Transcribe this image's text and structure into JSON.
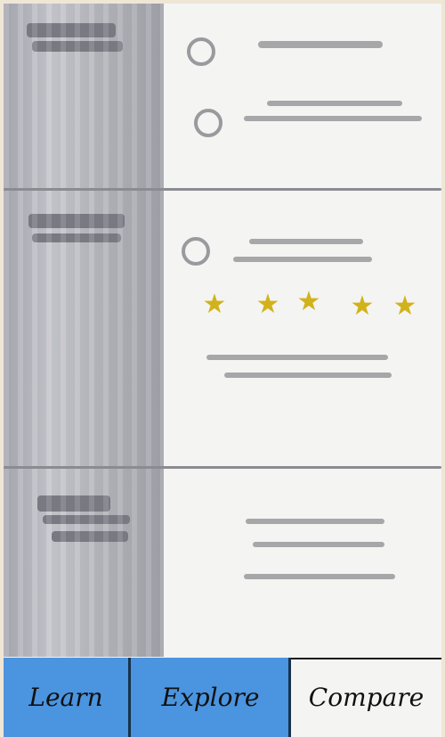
{
  "nav": {
    "tabs": [
      {
        "label": "Learn",
        "active": true
      },
      {
        "label": "Explore",
        "active": true
      },
      {
        "label": "Compare",
        "active": false
      }
    ]
  },
  "list": {
    "items": [
      {
        "type": "radio-list"
      },
      {
        "type": "rating",
        "stars": 5
      },
      {
        "type": "text"
      }
    ]
  },
  "colors": {
    "sidebar": "#b6b6bd",
    "accent": "#4b94df",
    "star": "#d2b21b"
  }
}
